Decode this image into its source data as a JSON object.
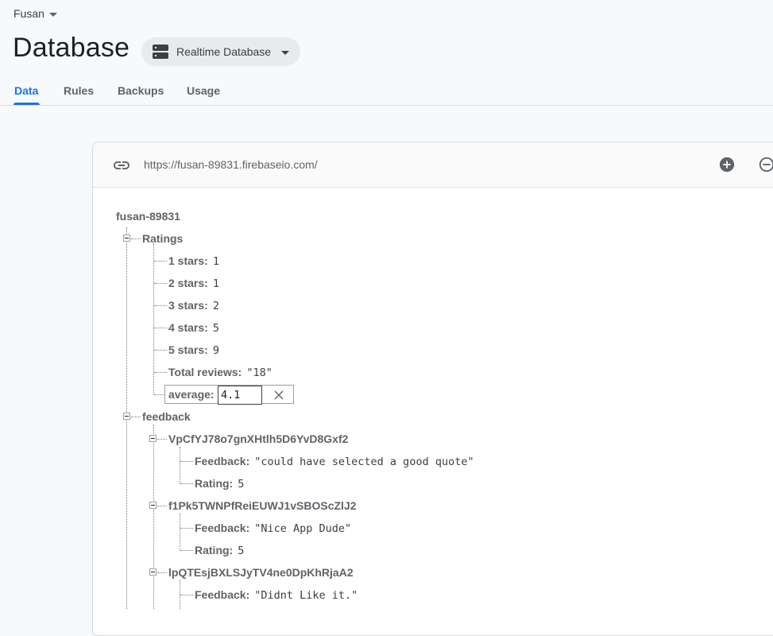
{
  "header": {
    "project_name": "Fusan",
    "page_title": "Database",
    "db_selector_label": "Realtime Database"
  },
  "tabs": [
    {
      "label": "Data",
      "active": true
    },
    {
      "label": "Rules",
      "active": false
    },
    {
      "label": "Backups",
      "active": false
    },
    {
      "label": "Usage",
      "active": false
    }
  ],
  "card": {
    "url": "https://fusan-89831.firebaseio.com/"
  },
  "tree": {
    "root": "fusan-89831",
    "ratings": {
      "key": "Ratings",
      "children": [
        {
          "key": "1 stars:",
          "value": "1"
        },
        {
          "key": "2 stars:",
          "value": "1"
        },
        {
          "key": "3 stars:",
          "value": "2"
        },
        {
          "key": "4 stars:",
          "value": "5"
        },
        {
          "key": "5 stars:",
          "value": "9"
        },
        {
          "key": "Total reviews:",
          "value": "\"18\""
        }
      ],
      "editing": {
        "key": "average:",
        "value": "4.1"
      }
    },
    "feedback": {
      "key": "feedback",
      "entries": [
        {
          "id": "VpCfYJ78o7gnXHtlh5D6YvD8Gxf2",
          "feedback_key": "Feedback:",
          "feedback_value": "\"could have selected a good quote\"",
          "rating_key": "Rating:",
          "rating_value": "5"
        },
        {
          "id": "f1Pk5TWNPfReiEUWJ1vSBOScZlJ2",
          "feedback_key": "Feedback:",
          "feedback_value": "\"Nice App Dude\"",
          "rating_key": "Rating:",
          "rating_value": "5"
        },
        {
          "id": "lpQTEsjBXLSJyTV4ne0DpKhRjaA2",
          "feedback_key": "Feedback:",
          "feedback_value": "\"Didnt Like it.\""
        }
      ]
    }
  },
  "colors": {
    "accent": "#1a73e8",
    "text_primary": "#202124",
    "key_text": "#5f6368"
  }
}
